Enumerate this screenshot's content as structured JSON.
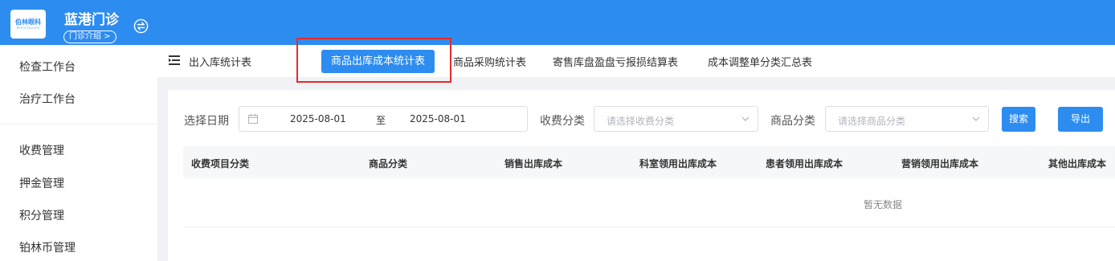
{
  "header": {
    "logo_main": "伯林眼科",
    "logo_sub": "Berlin Eyecare",
    "clinic_name": "蓝港门诊",
    "clinic_intro": "门诊介绍 >",
    "switch_icon": "switch-icon"
  },
  "sidebar": {
    "items": [
      {
        "label": "检查工作台"
      },
      {
        "label": "治疗工作台"
      },
      {
        "label": "收费管理"
      },
      {
        "label": "押金管理"
      },
      {
        "label": "积分管理"
      },
      {
        "label": "铂林币管理"
      }
    ]
  },
  "tabs": {
    "menu_icon": "menu-fold-icon",
    "items": [
      {
        "label": "出入库统计表"
      },
      {
        "label": "商品出库成本统计表"
      },
      {
        "label": "商品采购统计表"
      },
      {
        "label": "寄售库盘盈盘亏报损结算表"
      },
      {
        "label": "成本调整单分类汇总表"
      }
    ],
    "active_color": "#2d8cf0"
  },
  "filters": {
    "date_label": "选择日期",
    "date_start": "2025-08-01",
    "date_sep": "至",
    "date_end": "2025-08-01",
    "fee_label": "收费分类",
    "fee_placeholder": "请选择收费分类",
    "goods_label": "商品分类",
    "goods_placeholder": "请选择商品分类",
    "search_button": "搜索",
    "export_button": "导出"
  },
  "table": {
    "columns": [
      "收费项目分类",
      "商品分类",
      "销售出库成本",
      "科室领用出库成本",
      "患者领用出库成本",
      "营销领用出库成本",
      "其他出库成本"
    ],
    "rows": [],
    "empty_text": "暂无数据"
  },
  "colors": {
    "primary": "#2d8cf0",
    "highlight": "#e62a2a"
  }
}
